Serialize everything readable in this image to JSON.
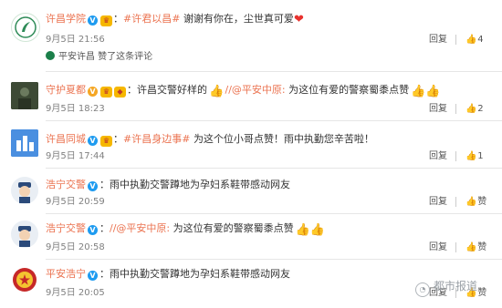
{
  "comments": [
    {
      "user": "许昌学院",
      "tags": [
        "#许君以昌#"
      ],
      "text": "谢谢有你在，尘世真可爱",
      "time": "9月5日 21:56",
      "reply_label": "回复",
      "likes": "4",
      "liked_by": "平安许昌 赞了这条评论"
    },
    {
      "user": "守护夏都",
      "pre_text": "许昌交警好样的",
      "mention": "//@平安中原:",
      "text": "为这位有爱的警察蜀黍点赞",
      "time": "9月5日 18:23",
      "reply_label": "回复",
      "likes": "2"
    },
    {
      "user": "许昌同城",
      "tags": [
        "#许昌身边事#"
      ],
      "text": "为这个位小哥点赞！雨中执勤您辛苦啦！",
      "time": "9月5日 17:44",
      "reply_label": "回复",
      "likes": "1"
    },
    {
      "user": "浩宁交警",
      "text": "雨中执勤交警蹲地为孕妇系鞋带感动网友",
      "time": "9月5日 20:59",
      "reply_label": "回复",
      "likes": "赞"
    },
    {
      "user": "浩宁交警",
      "mention": "//@平安中原:",
      "text": "为这位有爱的警察蜀黍点赞",
      "time": "9月5日 20:58",
      "reply_label": "回复",
      "likes": "赞"
    },
    {
      "user": "平安浩宁",
      "text": "雨中执勤交警蹲地为孕妇系鞋带感动网友",
      "time": "9月5日 20:05",
      "reply_label": "回复",
      "likes": "赞"
    }
  ],
  "watermark": "都市报道",
  "colors": {
    "accent": "#eb7350",
    "verified": "#1e9bf0",
    "divider": "#e6e6e6"
  }
}
